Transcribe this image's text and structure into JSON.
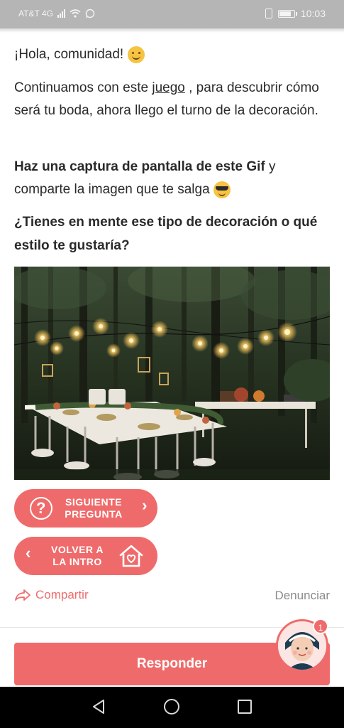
{
  "status_bar": {
    "carrier": "AT&T 4G",
    "time": "10:03"
  },
  "post": {
    "greeting": "¡Hola, comunidad!",
    "intro_before_link": "Continuamos con este ",
    "intro_link": "juego",
    "intro_after_link": " , para descubrir cómo será tu boda, ahora llego el turno de la decoración.",
    "instruction_bold": "Haz una captura de pantalla de este Gif",
    "instruction_rest": " y comparte la imagen que te salga",
    "question": "¿Tienes en mente ese tipo de decoración o qué estilo te gustaría?"
  },
  "buttons": {
    "next_line1": "SIGUIENTE",
    "next_line2": "PREGUNTA",
    "back_line1": "VOLVER A",
    "back_line2": "LA INTRO"
  },
  "actions": {
    "share": "Compartir",
    "report": "Denunciar"
  },
  "respond_button": "Responder",
  "notification_count": "1",
  "colors": {
    "accent": "#ef6b6b",
    "status_bar": "#b5b5b5",
    "nav_bar": "#000000"
  }
}
